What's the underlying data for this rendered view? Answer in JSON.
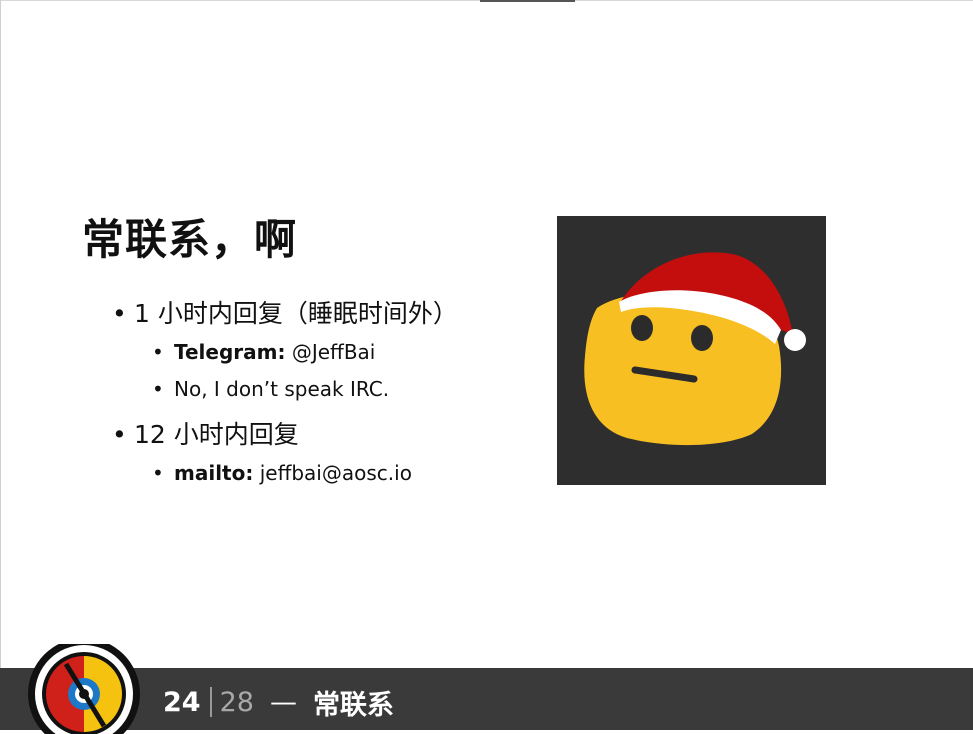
{
  "slide": {
    "title": "常联系，啊",
    "bullets": [
      {
        "text": "1 小时内回复（睡眠时间外）"
      },
      {
        "label": "Telegram:",
        "value": " @JeffBai"
      },
      {
        "text": "No, I don’t speak IRC."
      },
      {
        "text": "12 小时内回复"
      },
      {
        "label": "mailto:",
        "value": " jeffbai@aosc.io"
      }
    ]
  },
  "footer": {
    "current_page": "24",
    "total_pages": "28",
    "dash": "—",
    "section_title": "常联系"
  },
  "colors": {
    "footer_bg": "#3a3a3a",
    "emoji_face": "#f7bf22",
    "hat_red": "#c40d0d",
    "logo_red": "#d0201a",
    "logo_yellow": "#f5c20f",
    "logo_blue": "#1d79c8"
  },
  "icons": {
    "bullet": "bullet-dot",
    "image": "santa-hat-emoji",
    "logo": "aosc-logo"
  }
}
